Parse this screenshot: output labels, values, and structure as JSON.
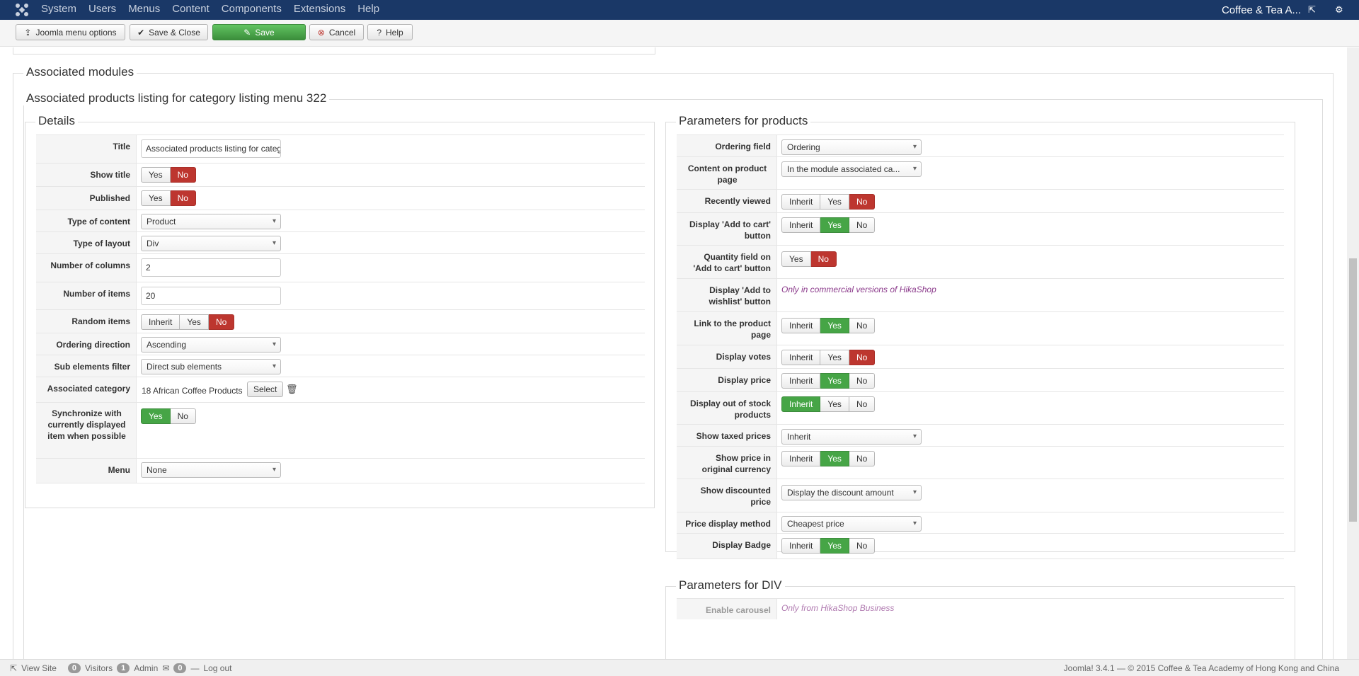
{
  "nav": {
    "menu": [
      "System",
      "Users",
      "Menus",
      "Content",
      "Components",
      "Extensions",
      "Help"
    ],
    "site_name": "Coffee & Tea A...",
    "external_icon": "external-link-icon",
    "settings_icon": "gear-icon"
  },
  "toolbar": {
    "menu_options": "Joomla menu options",
    "save_close": "Save & Close",
    "save": "Save",
    "cancel": "Cancel",
    "help": "Help"
  },
  "sections": {
    "associated_modules": "Associated modules",
    "module_title": "Associated products listing for category listing menu 322",
    "details": "Details",
    "params_products": "Parameters for products",
    "params_div": "Parameters for DIV"
  },
  "details": {
    "title_label": "Title",
    "title_value": "Associated products listing for category listing menu 322",
    "show_title_label": "Show title",
    "published_label": "Published",
    "type_content_label": "Type of content",
    "type_content_value": "Product",
    "type_layout_label": "Type of layout",
    "type_layout_value": "Div",
    "columns_label": "Number of columns",
    "columns_value": "2",
    "items_label": "Number of items",
    "items_value": "20",
    "random_label": "Random items",
    "ordering_dir_label": "Ordering direction",
    "ordering_dir_value": "Ascending",
    "sub_filter_label": "Sub elements filter",
    "sub_filter_value": "Direct sub elements",
    "assoc_cat_label": "Associated category",
    "assoc_cat_value": "18 African Coffee Products",
    "select_button": "Select",
    "sync_label": "Synchronize with currently displayed item when possible",
    "menu_label": "Menu",
    "menu_value": "None",
    "yes": "Yes",
    "no": "No",
    "inherit": "Inherit"
  },
  "params": {
    "ordering_field_label": "Ordering field",
    "ordering_field_value": "Ordering",
    "content_page_label": "Content on product page",
    "content_page_value": "In the module associated ca...",
    "recently_viewed_label": "Recently viewed",
    "add_to_cart_label": "Display 'Add to cart' button",
    "qty_field_label": "Quantity field on 'Add to cart' button",
    "wishlist_label": "Display 'Add to wishlist' button",
    "wishlist_note": "Only in commercial versions of HikaShop",
    "link_product_label": "Link to the product page",
    "votes_label": "Display votes",
    "price_label": "Display price",
    "out_of_stock_label": "Display out of stock products",
    "taxed_label": "Show taxed prices",
    "taxed_value": "Inherit",
    "orig_currency_label": "Show price in original currency",
    "discounted_label": "Show discounted price",
    "discounted_value": "Display the discount amount",
    "price_method_label": "Price display method",
    "price_method_value": "Cheapest price",
    "badge_label": "Display Badge",
    "carousel_label": "Enable carousel",
    "carousel_note": "Only from HikaShop Business"
  },
  "status": {
    "view_site": "View Site",
    "visitors_count": "0",
    "visitors": "Visitors",
    "admin_count": "1",
    "admin": "Admin",
    "messages_count": "0",
    "logout": "Log out",
    "footer": "Joomla! 3.4.1 — © 2015 Coffee & Tea Academy of Hong Kong and China"
  }
}
